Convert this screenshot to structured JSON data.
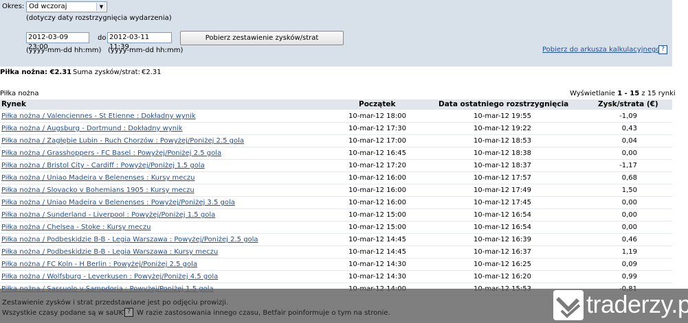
{
  "filter": {
    "period_label": "Okres:",
    "period_value": "Od wczoraj",
    "period_hint": "(dotyczy daty rozstrzygnięcia wydarzenia)",
    "date_from": "2012-03-09 23:00",
    "to_label": "do",
    "date_to": "2012-03-11 11:39",
    "date_format_hint_from": "(yyyy-mm-dd hh:mm)",
    "date_format_hint_to": "(yyyy-mm-dd hh:mm)",
    "fetch_button": "Pobierz zestawienie zysków/strat",
    "spreadsheet_link": "Pobierz do arkusza kalkulacyjnego",
    "help_glyph": "?"
  },
  "summary": {
    "sport_total": "Piłka nożna: €2.31",
    "sum_label": "Suma zysków/strat:",
    "sum_value": "€2.31"
  },
  "table": {
    "section_title": "Piłka nożna",
    "paging_prefix": "Wyświetlanie",
    "paging_range": "1 - 15",
    "paging_suffix": "z 15 rynki",
    "columns": [
      "Rynek",
      "Początek",
      "Data ostatniego rozstrzygnięcia",
      "Zysk/strata (€)"
    ],
    "rows": [
      {
        "market": "Piłka nożna / Valenciennes - St Etienne : Dokładny wynik",
        "start": "10-mar-12 18:00",
        "settled": "10-mar-12 19:55",
        "pnl": "-1,09"
      },
      {
        "market": "Piłka nożna / Augsburg - Dortmund : Dokładny wynik",
        "start": "10-mar-12 17:30",
        "settled": "10-mar-12 19:22",
        "pnl": "0,43"
      },
      {
        "market": "Piłka nożna / Zagłębie Lubin - Ruch Chorzów : Powyżej/Poniżej 2.5 gola",
        "start": "10-mar-12 17:00",
        "settled": "10-mar-12 18:53",
        "pnl": "0,04"
      },
      {
        "market": "Piłka nożna / Grasshoppers - FC Basel : Powyżej/Poniżej 2.5 gola",
        "start": "10-mar-12 16:45",
        "settled": "10-mar-12 18:38",
        "pnl": "0,00"
      },
      {
        "market": "Piłka nożna / Bristol City - Cardiff : Powyżej/Poniżej 1.5 gola",
        "start": "10-mar-12 17:20",
        "settled": "10-mar-12 18:37",
        "pnl": "-1,17"
      },
      {
        "market": "Piłka nożna / Uniao Madeira v Belenenses : Kursy meczu",
        "start": "10-mar-12 16:00",
        "settled": "10-mar-12 17:57",
        "pnl": "0,68"
      },
      {
        "market": "Piłka nożna / Slovacko v Bohemians 1905 : Kursy meczu",
        "start": "10-mar-12 16:00",
        "settled": "10-mar-12 17:49",
        "pnl": "1,50"
      },
      {
        "market": "Piłka nożna / Uniao Madeira v Belenenses : Powyżej/Poniżej 3.5 gola",
        "start": "10-mar-12 16:00",
        "settled": "10-mar-12 17:45",
        "pnl": "0,00"
      },
      {
        "market": "Piłka nożna / Sunderland - Liverpool : Powyżej/Poniżej 1.5 gola",
        "start": "10-mar-12 15:00",
        "settled": "10-mar-12 16:54",
        "pnl": "0,00"
      },
      {
        "market": "Piłka nożna / Chelsea - Stoke : Kursy meczu",
        "start": "10-mar-12 15:00",
        "settled": "10-mar-12 16:54",
        "pnl": "0,00"
      },
      {
        "market": "Piłka nożna / Podbeskidzie B-B - Legia Warszawa : Powyżej/Poniżej 2.5 gola",
        "start": "10-mar-12 14:45",
        "settled": "10-mar-12 16:39",
        "pnl": "0,46"
      },
      {
        "market": "Piłka nożna / Podbeskidzie B-B - Legia Warszawa : Kursy meczu",
        "start": "10-mar-12 14:45",
        "settled": "10-mar-12 16:37",
        "pnl": "1,19"
      },
      {
        "market": "Piłka nożna / FC Koln - H Berlin : Powyżej/Poniżej 2.5 gola",
        "start": "10-mar-12 14:30",
        "settled": "10-mar-12 16:25",
        "pnl": "0,09"
      },
      {
        "market": "Piłka nożna / Wolfsburg - Leverkusen : Powyżej/Poniżej 4.5 gola",
        "start": "10-mar-12 14:30",
        "settled": "10-mar-12 16:20",
        "pnl": "0,99"
      },
      {
        "market": "Piłka nożna / Sassuolo v Sampdoria : Powyżej/Poniżej 1.5 gola",
        "start": "10-mar-12 14:00",
        "settled": "10-mar-12 15:53",
        "pnl": "-0,81"
      }
    ]
  },
  "footer": {
    "line1": "Zestawienie zysków i strat przedstawiane jest po odjęciu prowizji.",
    "line2_a": "Wszystkie czasy podane są w saUKT",
    "line2_b": "W razie zastosowania innego czasu, Betfair poinformuje o tym na stronie.",
    "help_glyph": "?"
  },
  "watermark": {
    "text": "traderzy.pl"
  }
}
